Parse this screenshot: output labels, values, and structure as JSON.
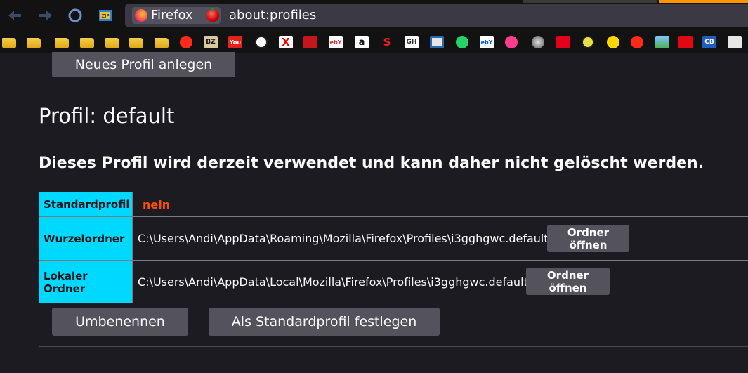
{
  "browser": {
    "identity_label": "Firefox",
    "url": "about:profiles",
    "icons": [
      "back-arrow-icon",
      "forward-arrow-icon",
      "sync-icon",
      "extension-icon",
      "firefox-logo-icon",
      "strawberry-extension-icon"
    ]
  },
  "bookmarks": {
    "items": [
      {
        "name": "folder-1-icon",
        "label": ""
      },
      {
        "name": "folder-2-icon",
        "label": ""
      },
      {
        "name": "folder-3-icon",
        "label": ""
      },
      {
        "name": "folder-4-icon",
        "label": ""
      },
      {
        "name": "folder-5-icon",
        "label": ""
      },
      {
        "name": "folder-6-icon",
        "label": ""
      },
      {
        "name": "firefox-bookmark-icon",
        "label": ""
      },
      {
        "name": "bz-bookmark-icon",
        "label": "BZ"
      },
      {
        "name": "youtube-bookmark-icon",
        "label": "You"
      },
      {
        "name": "circle-bookmark-icon",
        "label": ""
      },
      {
        "name": "x-bookmark-icon",
        "label": "X"
      },
      {
        "name": "red-square-bookmark-icon",
        "label": ""
      },
      {
        "name": "ebay-bookmark-icon",
        "label": "ebY"
      },
      {
        "name": "amazon-bookmark-icon",
        "label": "a"
      },
      {
        "name": "sparkasse-bookmark-icon",
        "label": "S"
      },
      {
        "name": "gh-bookmark-icon",
        "label": "GH"
      },
      {
        "name": "monitor-bookmark-icon",
        "label": ""
      },
      {
        "name": "whatsapp-bookmark-icon",
        "label": ""
      },
      {
        "name": "ebay-2-bookmark-icon",
        "label": "ebY"
      },
      {
        "name": "cloud-bookmark-icon",
        "label": ""
      },
      {
        "name": "gray-circle-bookmark-icon",
        "label": ""
      },
      {
        "name": "red-bookmark-icon",
        "label": ""
      },
      {
        "name": "face-bookmark-icon",
        "label": ""
      },
      {
        "name": "smiley-bookmark-icon",
        "label": ""
      },
      {
        "name": "firefox-2-bookmark-icon",
        "label": ""
      },
      {
        "name": "landscape-bookmark-icon",
        "label": ""
      },
      {
        "name": "fritz-bookmark-icon",
        "label": ""
      },
      {
        "name": "cb-bookmark-icon",
        "label": "CB"
      },
      {
        "name": "notepad-bookmark-icon",
        "label": ""
      }
    ]
  },
  "page": {
    "new_profile_button": "Neues Profil anlegen",
    "profile_title": "Profil: default",
    "profile_note": "Dieses Profil wird derzeit verwendet und kann daher nicht gelöscht werden.",
    "rows": [
      {
        "label": "Standardprofil",
        "value": "nein"
      },
      {
        "label": "Wurzelordner",
        "value": "C:\\Users\\Andi\\AppData\\Roaming\\Mozilla\\Firefox\\Profiles\\i3gghgwc.default",
        "button": "Ordner öffnen"
      },
      {
        "label": "Lokaler Ordner",
        "value": "C:\\Users\\Andi\\AppData\\Local\\Mozilla\\Firefox\\Profiles\\i3gghgwc.default",
        "button": "Ordner öffnen"
      }
    ],
    "rename_button": "Umbenennen",
    "set_default_button": "Als Standardprofil festlegen"
  },
  "colors": {
    "background": "#1c1b22",
    "header_cell": "#00d9ff",
    "no_value": "#ff4f00",
    "button": "#54535c"
  }
}
